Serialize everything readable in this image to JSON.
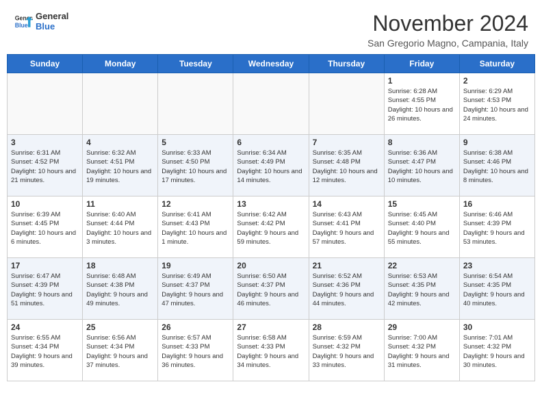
{
  "header": {
    "logo_line1": "General",
    "logo_line2": "Blue",
    "month": "November 2024",
    "location": "San Gregorio Magno, Campania, Italy"
  },
  "weekdays": [
    "Sunday",
    "Monday",
    "Tuesday",
    "Wednesday",
    "Thursday",
    "Friday",
    "Saturday"
  ],
  "weeks": [
    [
      {
        "day": "",
        "info": ""
      },
      {
        "day": "",
        "info": ""
      },
      {
        "day": "",
        "info": ""
      },
      {
        "day": "",
        "info": ""
      },
      {
        "day": "",
        "info": ""
      },
      {
        "day": "1",
        "info": "Sunrise: 6:28 AM\nSunset: 4:55 PM\nDaylight: 10 hours and 26 minutes."
      },
      {
        "day": "2",
        "info": "Sunrise: 6:29 AM\nSunset: 4:53 PM\nDaylight: 10 hours and 24 minutes."
      }
    ],
    [
      {
        "day": "3",
        "info": "Sunrise: 6:31 AM\nSunset: 4:52 PM\nDaylight: 10 hours and 21 minutes."
      },
      {
        "day": "4",
        "info": "Sunrise: 6:32 AM\nSunset: 4:51 PM\nDaylight: 10 hours and 19 minutes."
      },
      {
        "day": "5",
        "info": "Sunrise: 6:33 AM\nSunset: 4:50 PM\nDaylight: 10 hours and 17 minutes."
      },
      {
        "day": "6",
        "info": "Sunrise: 6:34 AM\nSunset: 4:49 PM\nDaylight: 10 hours and 14 minutes."
      },
      {
        "day": "7",
        "info": "Sunrise: 6:35 AM\nSunset: 4:48 PM\nDaylight: 10 hours and 12 minutes."
      },
      {
        "day": "8",
        "info": "Sunrise: 6:36 AM\nSunset: 4:47 PM\nDaylight: 10 hours and 10 minutes."
      },
      {
        "day": "9",
        "info": "Sunrise: 6:38 AM\nSunset: 4:46 PM\nDaylight: 10 hours and 8 minutes."
      }
    ],
    [
      {
        "day": "10",
        "info": "Sunrise: 6:39 AM\nSunset: 4:45 PM\nDaylight: 10 hours and 6 minutes."
      },
      {
        "day": "11",
        "info": "Sunrise: 6:40 AM\nSunset: 4:44 PM\nDaylight: 10 hours and 3 minutes."
      },
      {
        "day": "12",
        "info": "Sunrise: 6:41 AM\nSunset: 4:43 PM\nDaylight: 10 hours and 1 minute."
      },
      {
        "day": "13",
        "info": "Sunrise: 6:42 AM\nSunset: 4:42 PM\nDaylight: 9 hours and 59 minutes."
      },
      {
        "day": "14",
        "info": "Sunrise: 6:43 AM\nSunset: 4:41 PM\nDaylight: 9 hours and 57 minutes."
      },
      {
        "day": "15",
        "info": "Sunrise: 6:45 AM\nSunset: 4:40 PM\nDaylight: 9 hours and 55 minutes."
      },
      {
        "day": "16",
        "info": "Sunrise: 6:46 AM\nSunset: 4:39 PM\nDaylight: 9 hours and 53 minutes."
      }
    ],
    [
      {
        "day": "17",
        "info": "Sunrise: 6:47 AM\nSunset: 4:39 PM\nDaylight: 9 hours and 51 minutes."
      },
      {
        "day": "18",
        "info": "Sunrise: 6:48 AM\nSunset: 4:38 PM\nDaylight: 9 hours and 49 minutes."
      },
      {
        "day": "19",
        "info": "Sunrise: 6:49 AM\nSunset: 4:37 PM\nDaylight: 9 hours and 47 minutes."
      },
      {
        "day": "20",
        "info": "Sunrise: 6:50 AM\nSunset: 4:37 PM\nDaylight: 9 hours and 46 minutes."
      },
      {
        "day": "21",
        "info": "Sunrise: 6:52 AM\nSunset: 4:36 PM\nDaylight: 9 hours and 44 minutes."
      },
      {
        "day": "22",
        "info": "Sunrise: 6:53 AM\nSunset: 4:35 PM\nDaylight: 9 hours and 42 minutes."
      },
      {
        "day": "23",
        "info": "Sunrise: 6:54 AM\nSunset: 4:35 PM\nDaylight: 9 hours and 40 minutes."
      }
    ],
    [
      {
        "day": "24",
        "info": "Sunrise: 6:55 AM\nSunset: 4:34 PM\nDaylight: 9 hours and 39 minutes."
      },
      {
        "day": "25",
        "info": "Sunrise: 6:56 AM\nSunset: 4:34 PM\nDaylight: 9 hours and 37 minutes."
      },
      {
        "day": "26",
        "info": "Sunrise: 6:57 AM\nSunset: 4:33 PM\nDaylight: 9 hours and 36 minutes."
      },
      {
        "day": "27",
        "info": "Sunrise: 6:58 AM\nSunset: 4:33 PM\nDaylight: 9 hours and 34 minutes."
      },
      {
        "day": "28",
        "info": "Sunrise: 6:59 AM\nSunset: 4:32 PM\nDaylight: 9 hours and 33 minutes."
      },
      {
        "day": "29",
        "info": "Sunrise: 7:00 AM\nSunset: 4:32 PM\nDaylight: 9 hours and 31 minutes."
      },
      {
        "day": "30",
        "info": "Sunrise: 7:01 AM\nSunset: 4:32 PM\nDaylight: 9 hours and 30 minutes."
      }
    ]
  ]
}
